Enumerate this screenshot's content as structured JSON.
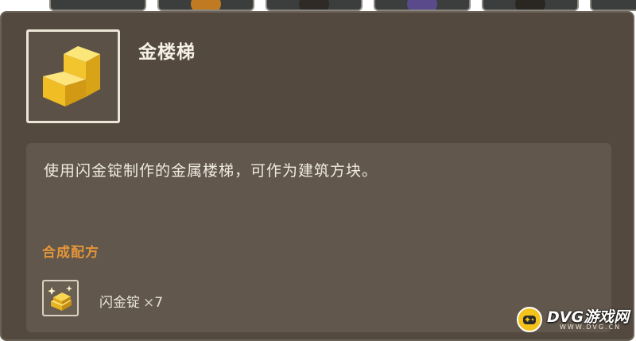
{
  "item": {
    "name": "金楼梯",
    "icon": "gold-stairs-icon",
    "description": "使用闪金锭制作的金属楼梯，可作为建筑方块。"
  },
  "recipe": {
    "title": "合成配方",
    "ingredients": [
      {
        "icon": "gold-ingot-icon",
        "name": "闪金锭",
        "separator": "×",
        "quantity": "7"
      }
    ]
  },
  "watermark": {
    "text": "DVG游戏网",
    "sub": "WWW.DVG.CN"
  },
  "colors": {
    "panel": "#53493f",
    "description_box": "#61574c",
    "recipe_title": "#e3953a",
    "gold": "#f2cf3a"
  }
}
